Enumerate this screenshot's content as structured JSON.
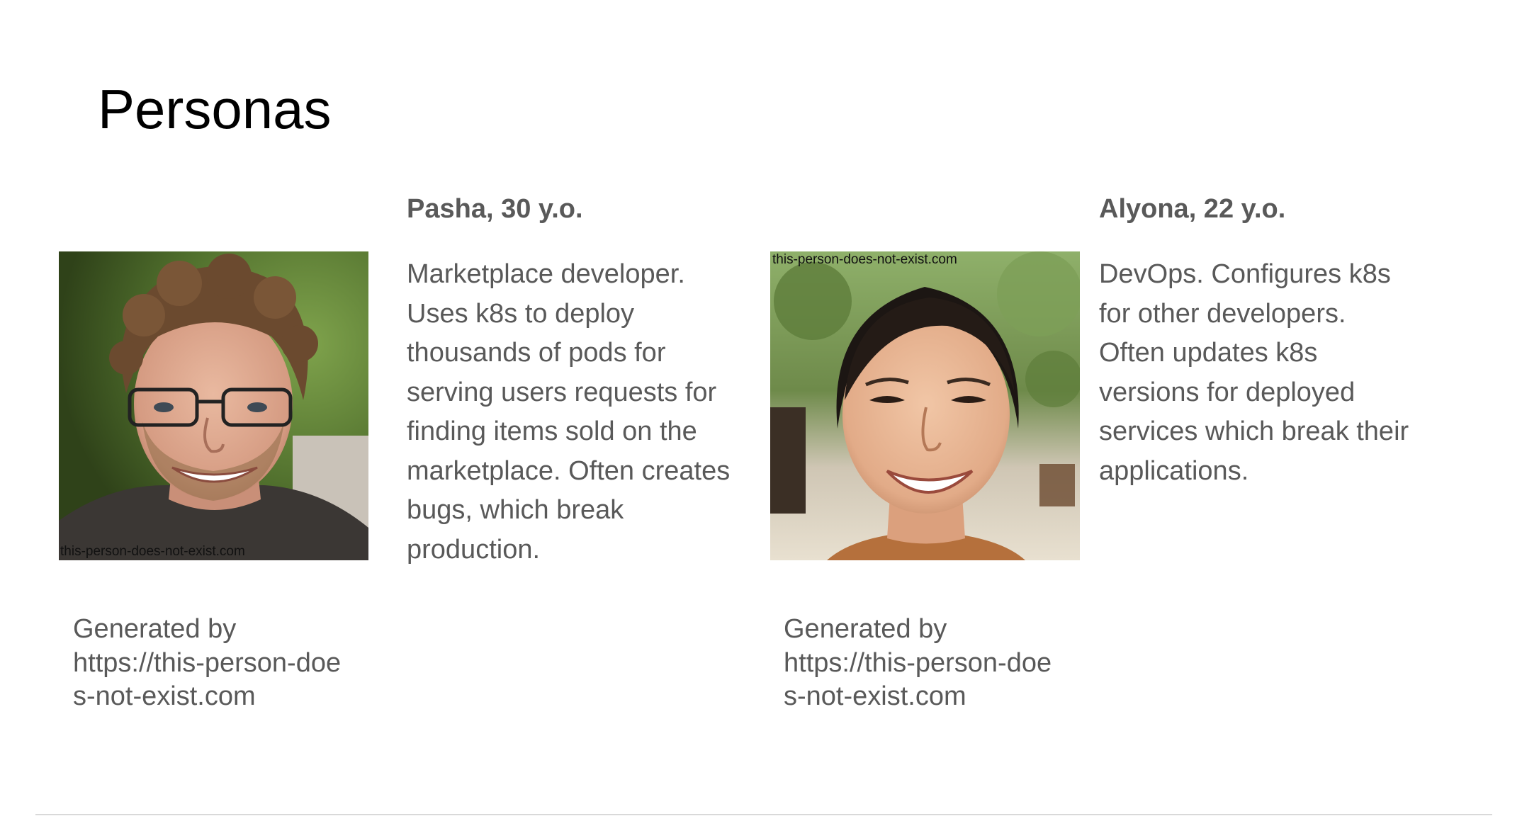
{
  "slide": {
    "title": "Personas"
  },
  "personas": [
    {
      "name": "Pasha, 30 y.o.",
      "description": "Marketplace developer.\nUses k8s to deploy\nthousands of pods for\nserving users requests for\nfinding items sold on the\nmarketplace. Often creates\nbugs, which break\nproduction.",
      "photo_watermark": "this-person-does-not-exist.com",
      "credit": "Generated by\nhttps://this-person-doe\ns-not-exist.com"
    },
    {
      "name": "Alyona, 22 y.o.",
      "description": "DevOps. Configures k8s\nfor other developers.\nOften updates k8s\nversions for deployed\nservices which break their\napplications.",
      "photo_watermark": "this-person-does-not-exist.com",
      "credit": "Generated by\nhttps://this-person-doe\ns-not-exist.com"
    }
  ],
  "colors": {
    "text": "#595959",
    "title": "#000000",
    "rule": "#d9d9d9"
  }
}
